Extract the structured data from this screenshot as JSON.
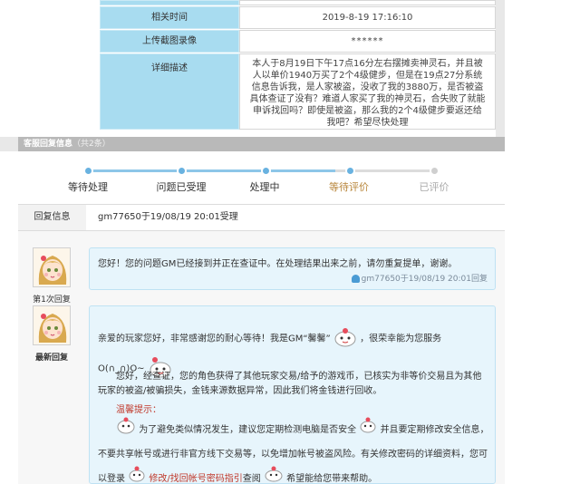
{
  "info": {
    "time_label": "相关时间",
    "time_value": "2019-8-19 17:16:10",
    "screenshot_label": "上传截图录像",
    "screenshot_value": "******",
    "desc_label": "详细描述",
    "desc_value": "本人于8月19日下午17点16分左右摆摊卖神灵石，并且被人以单价1940万买了2个4级健步，但是在19点27分系统信息告诉我，是人家被盗，没收了我的3880万，是否被盗具体查证了没有？难道人家买了我的神灵石，合失败了就能申诉找回吗？即使是被盗，那么我的2个4级健步要返还给我吧？希望尽快处理"
  },
  "section": {
    "title": "客服回复信息",
    "count": "（共2条）"
  },
  "progress": {
    "steps": [
      {
        "label": "等待处理",
        "state": "done"
      },
      {
        "label": "问题已受理",
        "state": "done"
      },
      {
        "label": "处理中",
        "state": "done"
      },
      {
        "label": "等待评价",
        "state": "current"
      },
      {
        "label": "已评价",
        "state": "todo"
      }
    ]
  },
  "reply_info": {
    "label": "回复信息",
    "value": "gm77650于19/08/19 20:01受理"
  },
  "replies": [
    {
      "tag": "第1次回复",
      "text": "您好！您的问题GM已经接到并正在查证中。在处理结果出来之前，请勿重复提单，谢谢。",
      "meta": "gm77650于19/08/19 20:01回复"
    },
    {
      "tag": "最新回复",
      "greeting_a": "亲爱的玩家您好，非常感谢您的耐心等待！我是GM“馨馨”",
      "greeting_b": "，很荣幸能为您服务",
      "kaomoji": "O(∩_∩)O~",
      "para1": "您好，经查证，您的角色获得了其他玩家交易/给予的游戏币，已核实为非等价交易且为其他玩家的被盗/被骗损失，金钱来源数据异常，因此我们将金钱进行回收。",
      "tip_title": "温馨提示：",
      "tip_a": "为了避免类似情况发生，建议您定期检测电脑是否安全",
      "tip_b": "并且要定期修改安全信息，不要共享帐号或进行非官方线下交易等，以免增加帐号被盗风险。有关修改密码的详细资料，您可以登录",
      "link": "修改/找回帐号密码指引",
      "tip_c": "查阅",
      "closing": "希望能给您带来帮助。"
    }
  ]
}
